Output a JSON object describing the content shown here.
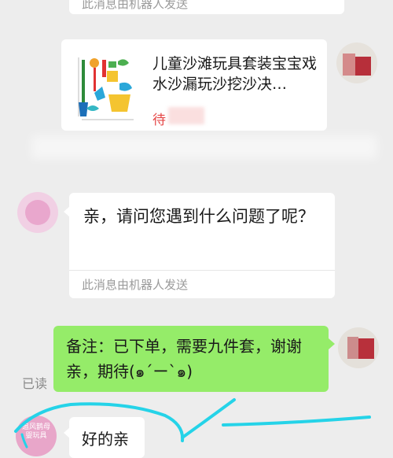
{
  "top_message": {
    "robot_note": "此消息由机器人发送"
  },
  "product_card": {
    "title": "儿童沙滩玩具套装宝宝戏水沙漏玩沙挖沙决…",
    "status": "待"
  },
  "bot_message": {
    "text": "亲，请问您遇到什么问题了呢？",
    "robot_note": "此消息由机器人发送"
  },
  "my_message": {
    "text": "备注：已下单，需要九件套，谢谢亲，期待(๑´ー`๑)",
    "read_status": "已读"
  },
  "last_message": {
    "text": "好的亲",
    "avatar_label": "追风鹊母婴玩具"
  },
  "colors": {
    "green_bubble": "#95ec69",
    "background": "#ededed",
    "annotation": "#25d3e8"
  }
}
